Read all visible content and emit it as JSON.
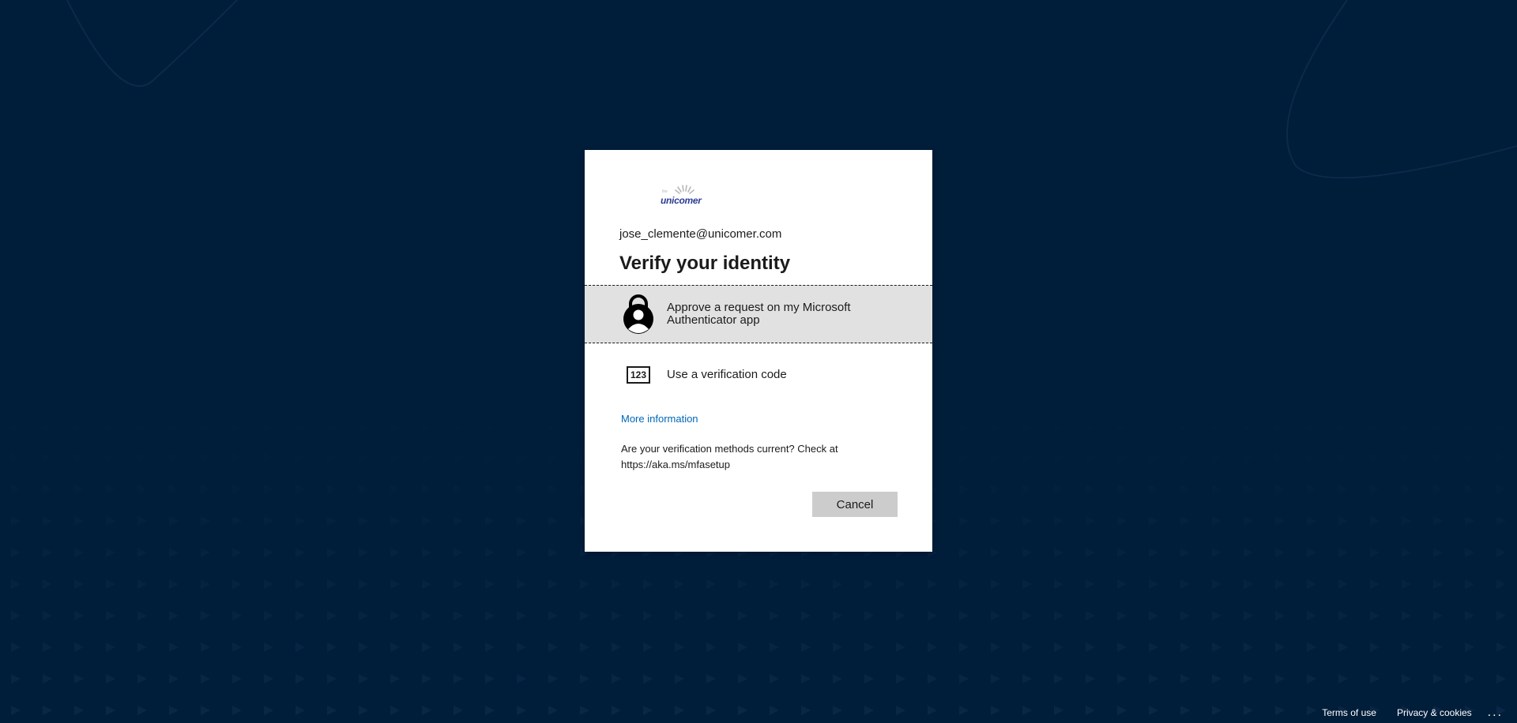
{
  "account": {
    "email": "jose_clemente@unicomer.com"
  },
  "logo": {
    "text": "unicomer"
  },
  "dialog": {
    "title": "Verify your identity",
    "options": [
      {
        "label": "Approve a request on my Microsoft Authenticator app",
        "icon": "authenticator-lock-icon",
        "selected": true
      },
      {
        "label": "Use a verification code",
        "icon": "verification-code-icon",
        "icon_text": "123",
        "selected": false
      }
    ],
    "more_info_link": "More information",
    "methods_note": "Are your verification methods current? Check at https://aka.ms/mfasetup",
    "cancel_label": "Cancel"
  },
  "footer": {
    "terms_label": "Terms of use",
    "privacy_label": "Privacy & cookies",
    "more_label": "..."
  },
  "colors": {
    "background": "#001d3a",
    "card": "#ffffff",
    "selected_option": "#e1e1e1",
    "link": "#0067b8",
    "cancel_button": "#cccccc",
    "logo": "#2c3e94"
  }
}
